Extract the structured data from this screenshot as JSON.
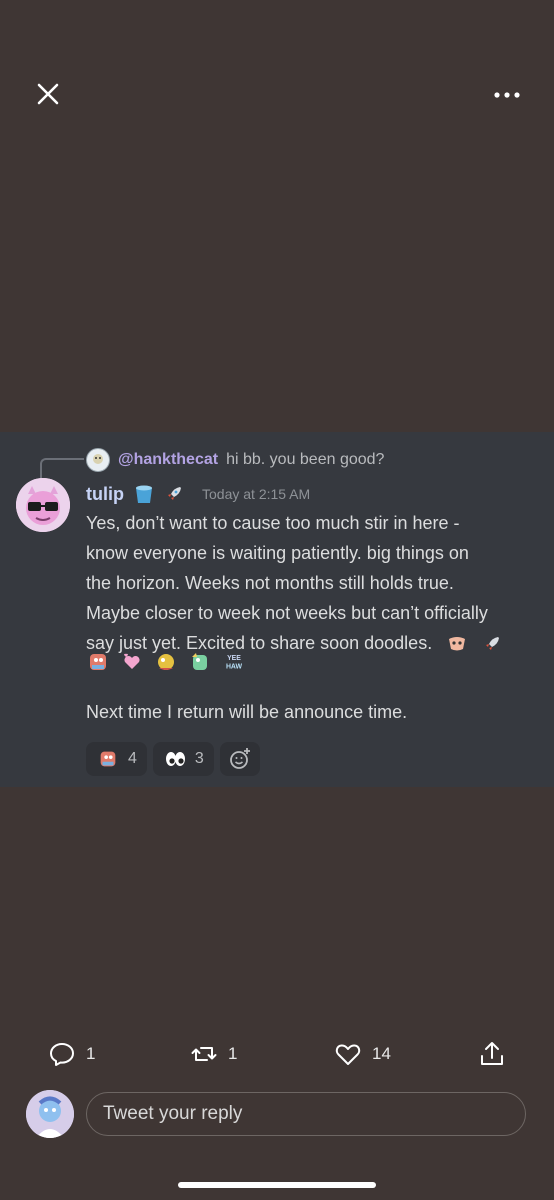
{
  "header": {
    "close_icon": "close-icon",
    "more_icon": "more-horizontal-icon"
  },
  "message": {
    "reply": {
      "username": "@hankthecat",
      "text": "hi bb. you been good?"
    },
    "author": "tulip",
    "timestamp": "Today at 2:15 AM",
    "body_lines": [
      "Yes, don’t want to cause too much stir in here -",
      "know everyone is waiting patiently. big things on",
      "the horizon. Weeks not months still holds true.",
      "Maybe closer to week not weeks but can’t officially",
      "say just yet. Excited to share soon doodles."
    ],
    "footer_text": "Next time I return will be announce time.",
    "reactions": [
      {
        "emoji": "doodle-character-emoji",
        "count": "4"
      },
      {
        "emoji": "eyes-emoji",
        "count": "3"
      }
    ],
    "add_reaction_icon": "add-reaction-icon",
    "yee_haw_label": "YEE HAW"
  },
  "tweet_actions": {
    "reply_count": "1",
    "retweet_count": "1",
    "like_count": "14"
  },
  "reply_bar": {
    "placeholder": "Tweet your reply"
  },
  "colors": {
    "background": "#3f3634",
    "card": "#36393f",
    "reply_username": "#b3a3e3",
    "author_name": "#c6d3f6"
  }
}
